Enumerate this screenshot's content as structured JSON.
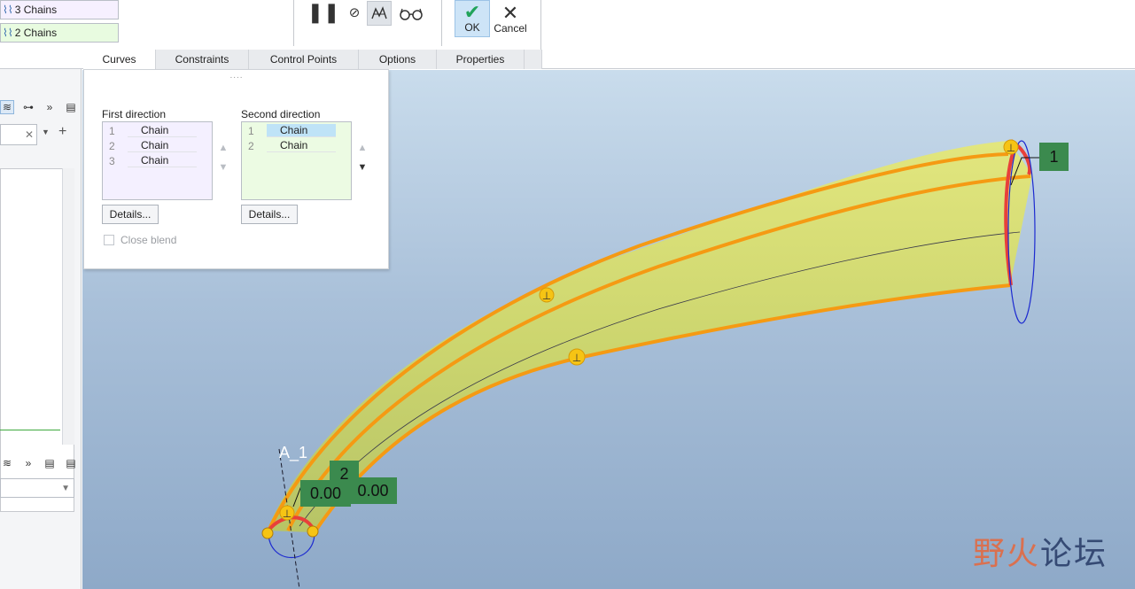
{
  "collectors": {
    "first": "3 Chains",
    "second": "2 Chains"
  },
  "toolbar": {
    "ok_label": "OK",
    "cancel_label": "Cancel"
  },
  "tabs": [
    "Curves",
    "Constraints",
    "Control Points",
    "Options",
    "Properties"
  ],
  "curves_panel": {
    "grip": "....",
    "first_direction_label": "First direction",
    "second_direction_label": "Second direction",
    "first_rows": [
      {
        "num": "1",
        "name": "Chain"
      },
      {
        "num": "2",
        "name": "Chain"
      },
      {
        "num": "3",
        "name": "Chain"
      }
    ],
    "second_rows": [
      {
        "num": "1",
        "name": "Chain"
      },
      {
        "num": "2",
        "name": "Chain"
      }
    ],
    "details_label": "Details...",
    "close_blend_label": "Close blend"
  },
  "viewport": {
    "tag_1": "1",
    "tag_2": "2",
    "dim_a": "0.00",
    "dim_b": "0.00",
    "axis_label": "A_1"
  },
  "watermark": {
    "text_a": "野火",
    "text_b": "论坛"
  },
  "colors": {
    "surface": "#c8d36a",
    "chain_orange": "#f59a13",
    "chain_red": "#e8403a",
    "tag_green": "#3b8a4e",
    "selected_row": "#bfe3f7"
  }
}
